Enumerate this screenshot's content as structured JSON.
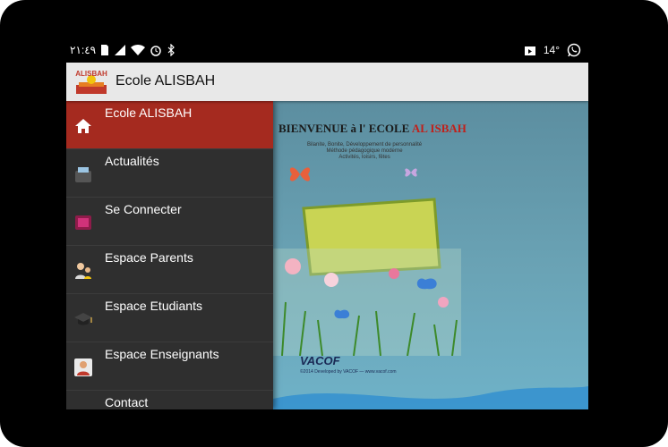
{
  "status_bar": {
    "time": "٢١:٤٩",
    "temperature": "14°",
    "icons": [
      "sim-icon",
      "signal-icon",
      "wifi-icon",
      "alarm-icon",
      "bluetooth-icon",
      "media-icon",
      "whatsapp-icon"
    ]
  },
  "app_bar": {
    "logo_text": "ALISBAH",
    "title": "Ecole ALISBAH"
  },
  "drawer": {
    "items": [
      {
        "label": "Ecole ALISBAH",
        "icon": "home-icon",
        "active": true
      },
      {
        "label": "Actualités",
        "icon": "news-icon",
        "active": false
      },
      {
        "label": "Se Connecter",
        "icon": "login-icon",
        "active": false
      },
      {
        "label": "Espace Parents",
        "icon": "parents-icon",
        "active": false
      },
      {
        "label": "Espace Etudiants",
        "icon": "graduation-cap-icon",
        "active": false
      },
      {
        "label": "Espace Enseignants",
        "icon": "teacher-icon",
        "active": false
      },
      {
        "label": "Contact",
        "icon": "contact-icon",
        "active": false
      }
    ]
  },
  "banner": {
    "title_black": "BIENVENUE à l' ECOLE",
    "title_red": "AL ISBAH",
    "subtitle": [
      "Bilanite, Bonite, Développement de personnalité",
      "Méthode pédagogique moderne",
      "Activités, loisirs, fêtes"
    ],
    "footer_brand": "VACOF",
    "footer_sub": "©2014 Developed by VACOF — www.vacof.com"
  },
  "colors": {
    "active_item": "#a52a1f",
    "drawer_bg": "#2f2f2f",
    "app_bar_bg": "#e8e8e8"
  }
}
